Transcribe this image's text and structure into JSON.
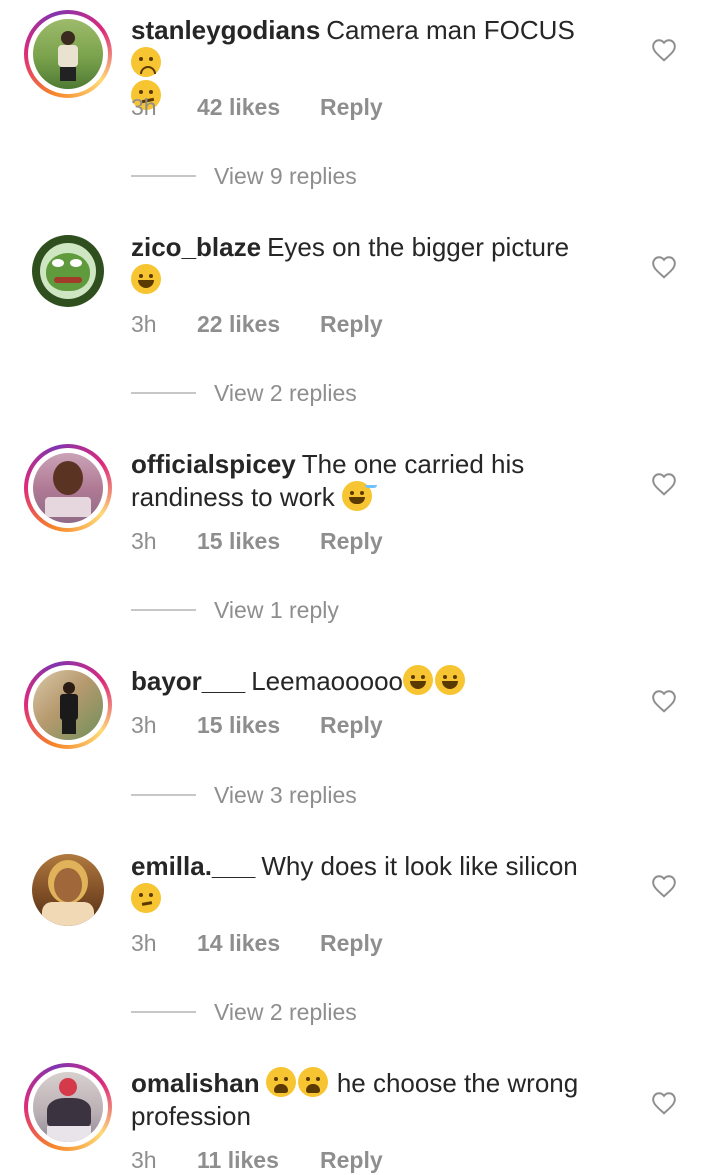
{
  "comments": [
    {
      "username": "stanleygodians",
      "text": "Camera man FOCUS",
      "emojis_inline": [
        "frown"
      ],
      "emojis_line2": [
        "smirk"
      ],
      "time": "3h",
      "likes": "42 likes",
      "reply": "Reply",
      "view_replies": "View 9 replies",
      "avatar_icon": "person-photo",
      "story_ring": true
    },
    {
      "username": "zico_blaze",
      "text": "Eyes on the bigger picture",
      "emojis_inline": [],
      "emojis_line2": [
        "laugh"
      ],
      "time": "3h",
      "likes": "22 likes",
      "reply": "Reply",
      "view_replies": "View 2 replies",
      "avatar_icon": "frog-avatar",
      "story_ring": false
    },
    {
      "username": "officialspicey",
      "text": "The one carried his randiness to work",
      "emojis_inline": [
        "sweat"
      ],
      "emojis_line2": [],
      "time": "3h",
      "likes": "15 likes",
      "reply": "Reply",
      "view_replies": "View 1 reply",
      "avatar_icon": "person-photo",
      "story_ring": true
    },
    {
      "username": "bayor___",
      "text": "Leemaooooo",
      "emojis_inline": [
        "laugh",
        "laugh"
      ],
      "emojis_line2": [],
      "time": "3h",
      "likes": "15 likes",
      "reply": "Reply",
      "view_replies": "View 3 replies",
      "avatar_icon": "person-photo",
      "story_ring": true
    },
    {
      "username": "emilla.___",
      "text": "Why does it look like silicon",
      "emojis_inline": [],
      "emojis_line2": [
        "think"
      ],
      "time": "3h",
      "likes": "14 likes",
      "reply": "Reply",
      "view_replies": "View 2 replies",
      "avatar_icon": "person-photo",
      "story_ring": false
    },
    {
      "username": "omalishan",
      "text": "he choose the wrong profession",
      "emojis_before": [
        "weary",
        "weary"
      ],
      "time": "3h",
      "likes": "11 likes",
      "reply": "Reply",
      "avatar_icon": "person-photo",
      "story_ring": true
    }
  ],
  "icons": {
    "like": "heart-outline-icon"
  },
  "colors": {
    "text": "#262626",
    "muted": "#8e8e8e",
    "divider": "#c7c7c7"
  }
}
